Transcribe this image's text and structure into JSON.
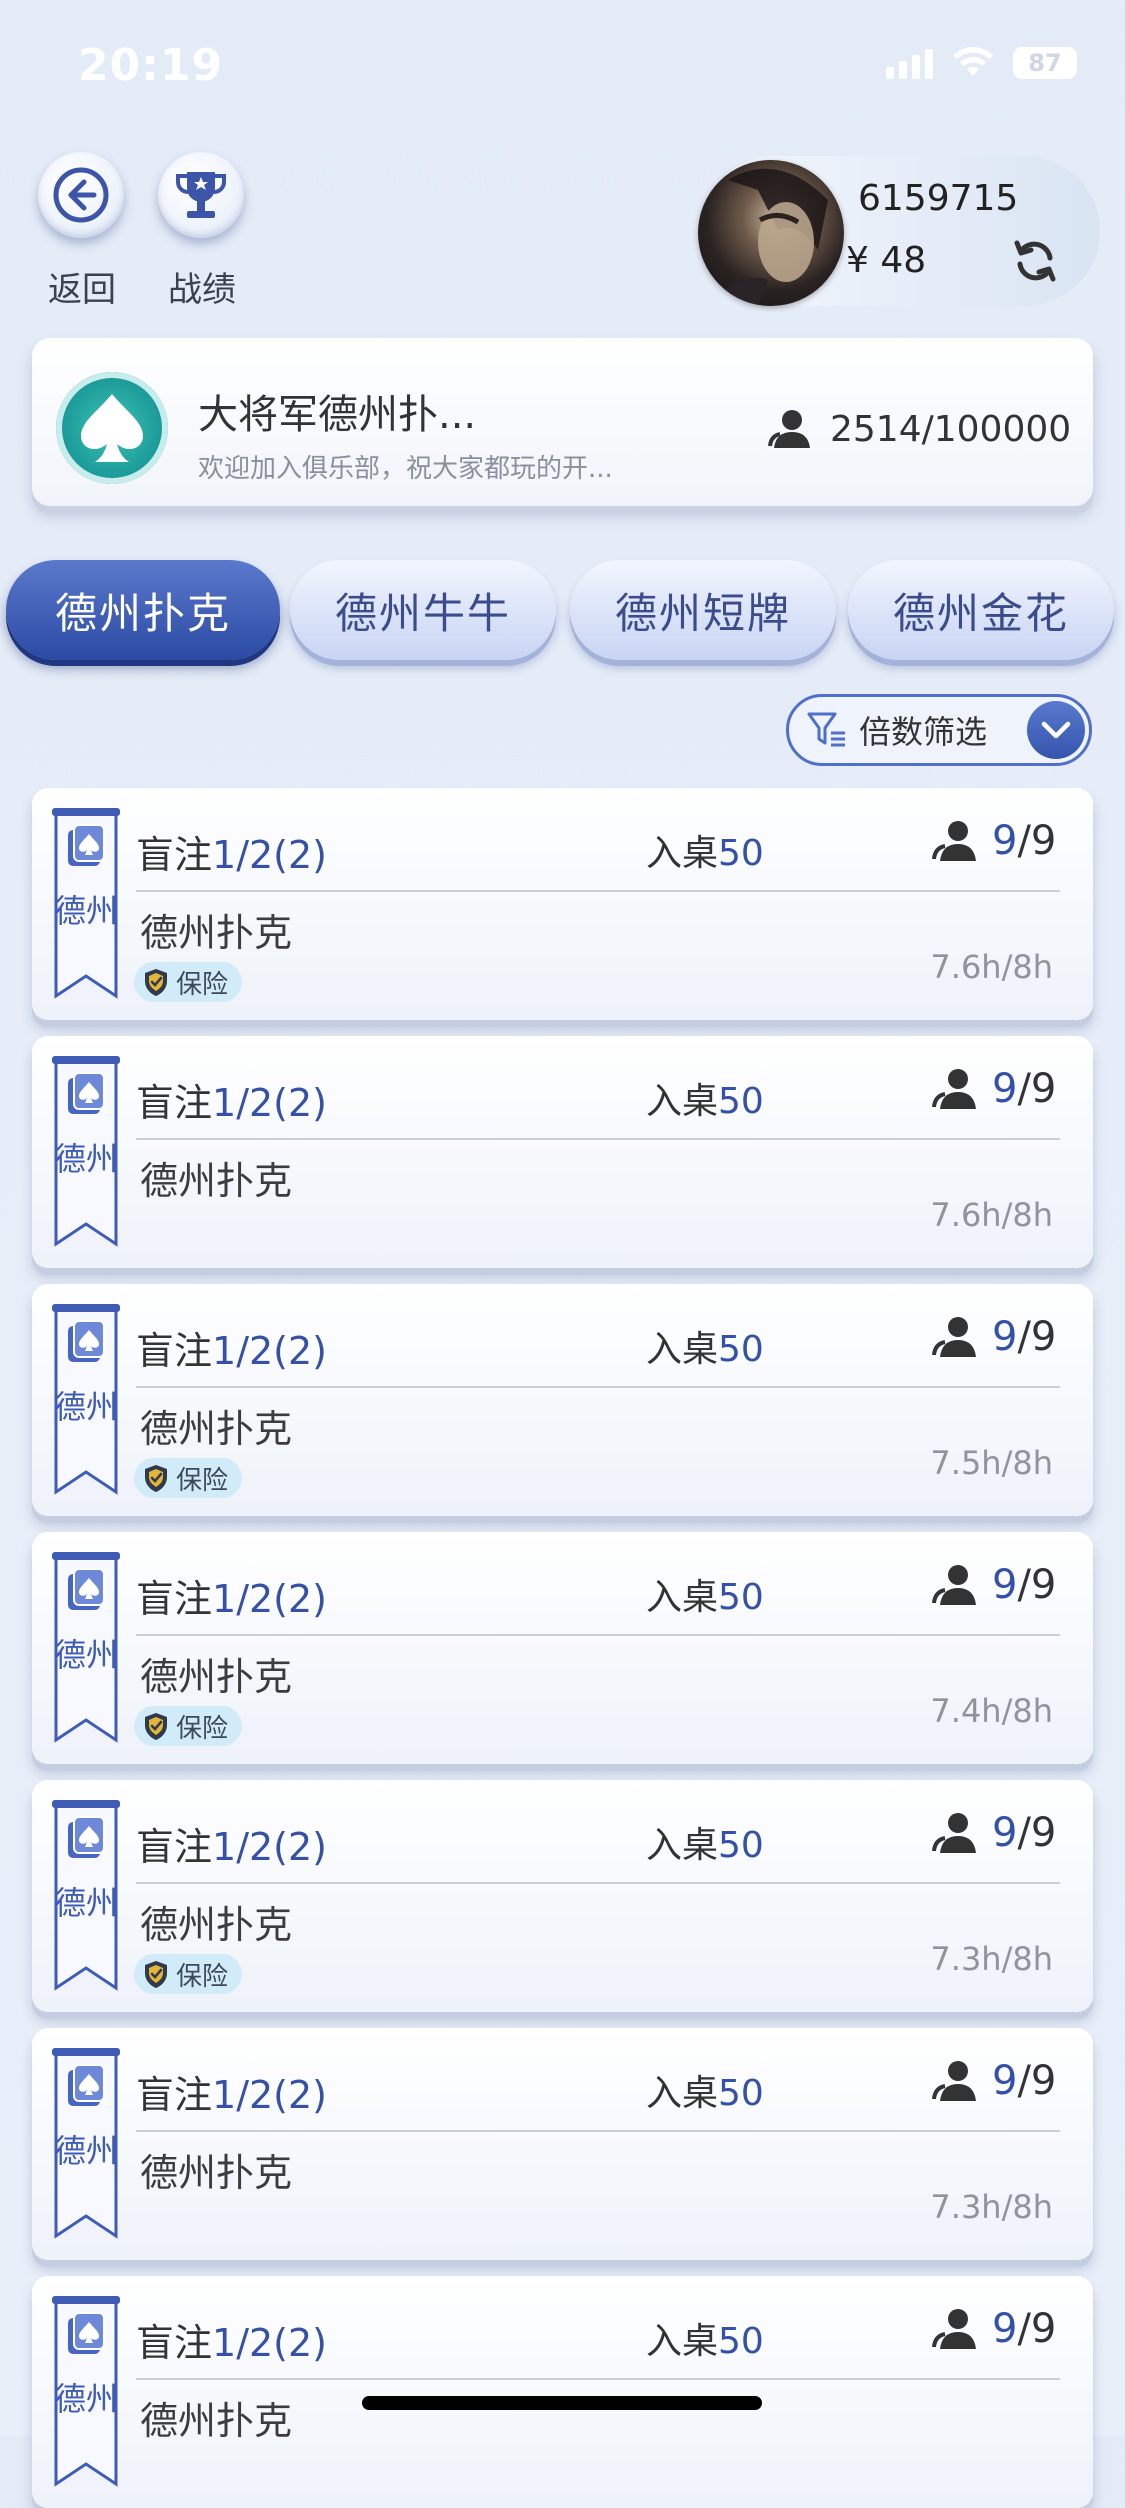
{
  "status_bar": {
    "time": "20:19",
    "battery": "87"
  },
  "top": {
    "back_label": "返回",
    "record_label": "战绩",
    "user_id": "6159715",
    "balance": "¥ 48"
  },
  "club": {
    "name": "大将军德州扑...",
    "description": "欢迎加入俱乐部，祝大家都玩的开...",
    "members": "2514/100000"
  },
  "tabs": [
    {
      "label": "德州扑克",
      "active": true
    },
    {
      "label": "德州牛牛",
      "active": false
    },
    {
      "label": "德州短牌",
      "active": false
    },
    {
      "label": "德州金花",
      "active": false
    }
  ],
  "filter": {
    "label": "倍数筛选"
  },
  "rooms": [
    {
      "ribbon": "德州",
      "blind_label": "盲注",
      "blind": "1/2(2)",
      "entry_label": "入桌",
      "entry": "50",
      "seats_now": "9",
      "seats_total": "/9",
      "game": "德州扑克",
      "insurance": "保险",
      "duration": "7.6h/8h"
    },
    {
      "ribbon": "德州",
      "blind_label": "盲注",
      "blind": "1/2(2)",
      "entry_label": "入桌",
      "entry": "50",
      "seats_now": "9",
      "seats_total": "/9",
      "game": "德州扑克",
      "insurance": "",
      "duration": "7.6h/8h"
    },
    {
      "ribbon": "德州",
      "blind_label": "盲注",
      "blind": "1/2(2)",
      "entry_label": "入桌",
      "entry": "50",
      "seats_now": "9",
      "seats_total": "/9",
      "game": "德州扑克",
      "insurance": "保险",
      "duration": "7.5h/8h"
    },
    {
      "ribbon": "德州",
      "blind_label": "盲注",
      "blind": "1/2(2)",
      "entry_label": "入桌",
      "entry": "50",
      "seats_now": "9",
      "seats_total": "/9",
      "game": "德州扑克",
      "insurance": "保险",
      "duration": "7.4h/8h"
    },
    {
      "ribbon": "德州",
      "blind_label": "盲注",
      "blind": "1/2(2)",
      "entry_label": "入桌",
      "entry": "50",
      "seats_now": "9",
      "seats_total": "/9",
      "game": "德州扑克",
      "insurance": "保险",
      "duration": "7.3h/8h"
    },
    {
      "ribbon": "德州",
      "blind_label": "盲注",
      "blind": "1/2(2)",
      "entry_label": "入桌",
      "entry": "50",
      "seats_now": "9",
      "seats_total": "/9",
      "game": "德州扑克",
      "insurance": "",
      "duration": "7.3h/8h"
    },
    {
      "ribbon": "德州",
      "blind_label": "盲注",
      "blind": "1/2(2)",
      "entry_label": "入桌",
      "entry": "50",
      "seats_now": "9",
      "seats_total": "/9",
      "game": "德州扑克",
      "insurance": "",
      "duration": ""
    }
  ],
  "colors": {
    "accent": "#3550a8",
    "tab_active": "#2b4aa3",
    "club_logo": "#1c9c9a"
  }
}
